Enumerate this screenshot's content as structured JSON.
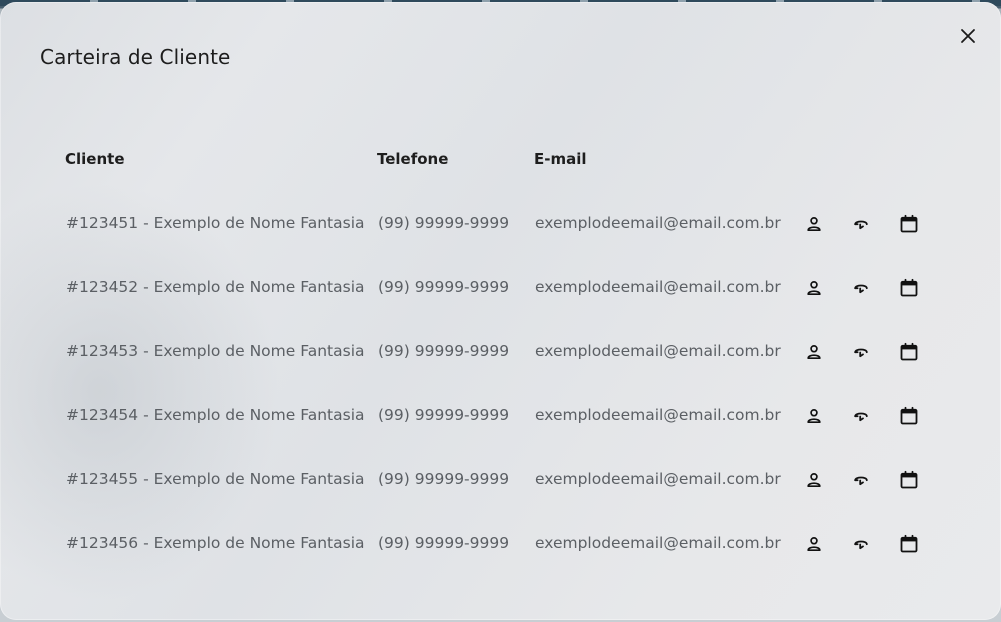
{
  "modal": {
    "title": "Carteira de Cliente",
    "close_icon": "close-icon"
  },
  "table": {
    "headers": {
      "client": "Cliente",
      "phone": "Telefone",
      "email": "E-mail"
    },
    "rows": [
      {
        "client": "#123451 - Exemplo de Nome Fantasia",
        "phone": "(99) 99999-9999",
        "email": "exemplodeemail@email.com.br"
      },
      {
        "client": "#123452 - Exemplo de Nome Fantasia",
        "phone": "(99) 99999-9999",
        "email": "exemplodeemail@email.com.br"
      },
      {
        "client": "#123453 - Exemplo de Nome Fantasia",
        "phone": "(99) 99999-9999",
        "email": "exemplodeemail@email.com.br"
      },
      {
        "client": "#123454 - Exemplo de Nome Fantasia",
        "phone": "(99) 99999-9999",
        "email": "exemplodeemail@email.com.br"
      },
      {
        "client": "#123455 - Exemplo de Nome Fantasia",
        "phone": "(99) 99999-9999",
        "email": "exemplodeemail@email.com.br"
      },
      {
        "client": "#123456 - Exemplo de Nome Fantasia",
        "phone": "(99) 99999-9999",
        "email": "exemplodeemail@email.com.br"
      }
    ],
    "row_actions": [
      "user-icon",
      "swap-icon",
      "calendar-icon"
    ]
  },
  "colors": {
    "text_primary": "#1d1d1d",
    "text_secondary": "#5b5f64",
    "icon": "#111111"
  }
}
